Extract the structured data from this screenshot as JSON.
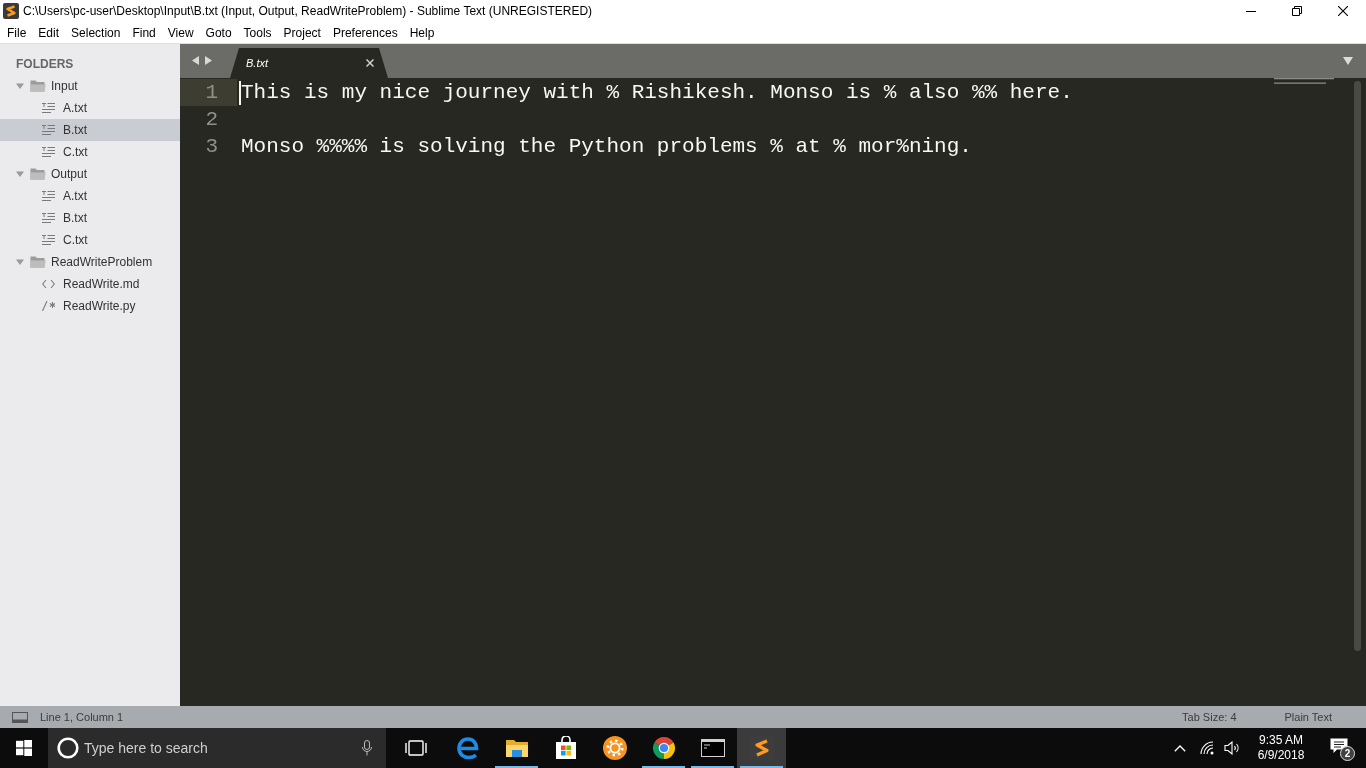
{
  "window": {
    "title": "C:\\Users\\pc-user\\Desktop\\Input\\B.txt (Input, Output, ReadWriteProblem) - Sublime Text (UNREGISTERED)"
  },
  "menu": [
    "File",
    "Edit",
    "Selection",
    "Find",
    "View",
    "Goto",
    "Tools",
    "Project",
    "Preferences",
    "Help"
  ],
  "sidebar": {
    "heading": "FOLDERS",
    "folders": [
      {
        "name": "Input",
        "expanded": true,
        "selected": false,
        "children": [
          {
            "name": "A.txt",
            "kind": "text",
            "selected": false
          },
          {
            "name": "B.txt",
            "kind": "text",
            "selected": true
          },
          {
            "name": "C.txt",
            "kind": "text",
            "selected": false
          }
        ]
      },
      {
        "name": "Output",
        "expanded": true,
        "selected": false,
        "children": [
          {
            "name": "A.txt",
            "kind": "text",
            "selected": false
          },
          {
            "name": "B.txt",
            "kind": "text",
            "selected": false
          },
          {
            "name": "C.txt",
            "kind": "text",
            "selected": false
          }
        ]
      },
      {
        "name": "ReadWriteProblem",
        "expanded": true,
        "selected": false,
        "children": [
          {
            "name": "ReadWrite.md",
            "kind": "markup",
            "selected": false
          },
          {
            "name": "ReadWrite.py",
            "kind": "code",
            "selected": false
          }
        ]
      }
    ]
  },
  "tabs": [
    {
      "label": "B.txt",
      "selected": true
    }
  ],
  "editor": {
    "lines": [
      {
        "number": "1",
        "text": "This is my nice journey with % Rishikesh. Monso is % also %% here.",
        "current": true
      },
      {
        "number": "2",
        "current": false
      },
      {
        "number": "3",
        "text": "Monso %%%% is solving the Python problems % at % mor%ning.",
        "current": false
      }
    ]
  },
  "status_bar": {
    "position": "Line 1, Column 1",
    "tab_size": "Tab Size: 4",
    "syntax": "Plain Text"
  },
  "taskbar": {
    "search": {
      "placeholder": "Type here to search"
    },
    "apps": [
      {
        "kind": "swirl",
        "running": false,
        "selected": false
      },
      {
        "kind": "folder",
        "running": true,
        "selected": false
      },
      {
        "kind": "bag",
        "running": false,
        "selected": false
      },
      {
        "kind": "gear",
        "running": false,
        "selected": false
      },
      {
        "kind": "orb",
        "running": true,
        "selected": false
      },
      {
        "kind": "terminal",
        "running": true,
        "selected": false
      },
      {
        "kind": "editor",
        "running": true,
        "selected": true
      }
    ],
    "time": "9:35 AM",
    "date": "6/9/2018",
    "notifications": "2"
  }
}
